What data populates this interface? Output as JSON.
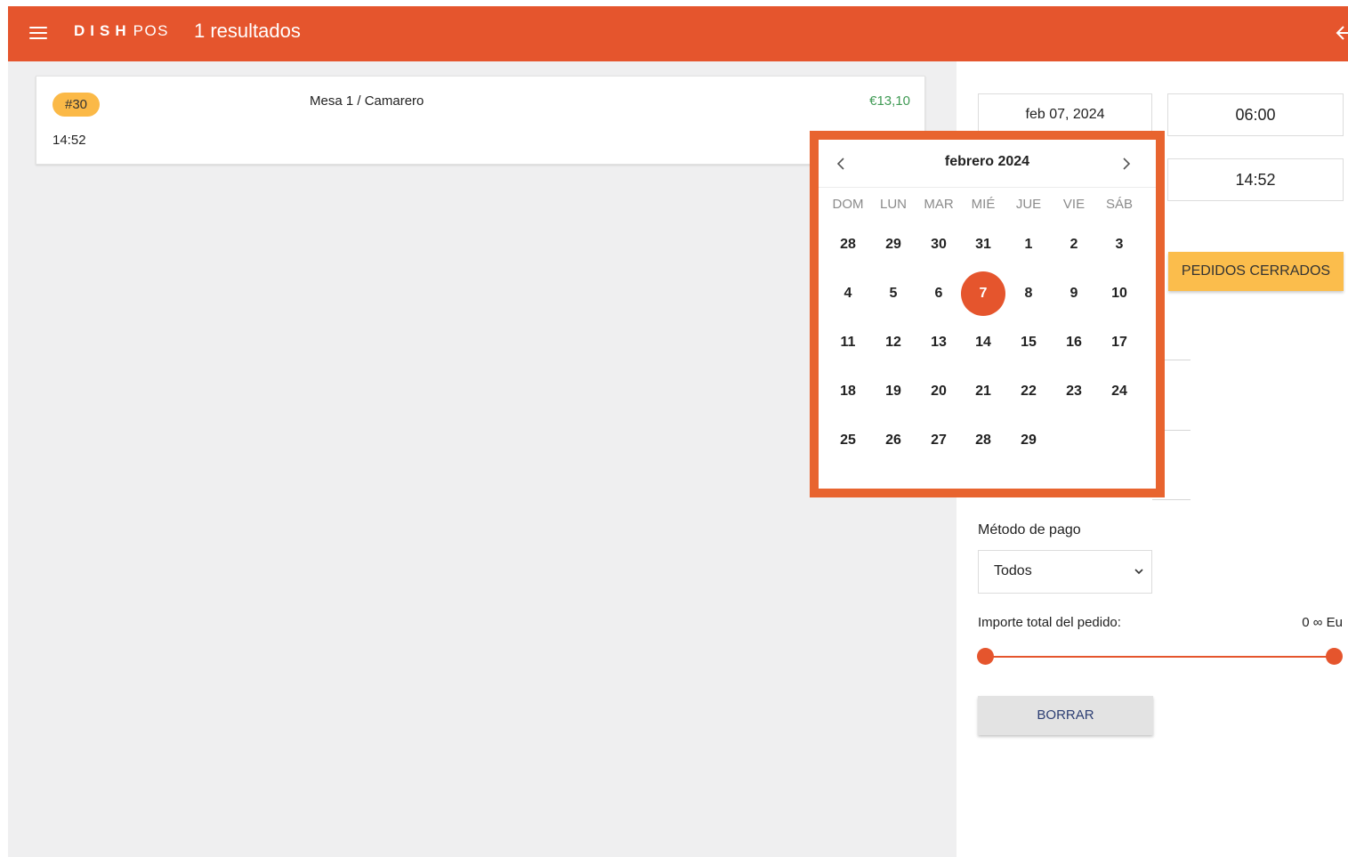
{
  "header": {
    "menu_icon": "hamburger-menu-icon",
    "brand_bold": "DISH",
    "brand_light": "POS",
    "title": "1 resultados",
    "back_icon": "back-arrow-icon"
  },
  "colors": {
    "primary": "#e5552d",
    "accent_yellow": "#fbbd4c",
    "price_green": "#3f9a54",
    "panel_gray": "#efeff0"
  },
  "orders": [
    {
      "badge": "#30",
      "table": "Mesa 1 / Camarero",
      "amount": "€13,10",
      "time": "14:52"
    }
  ],
  "filters": {
    "date": "feb 07, 2024",
    "time_from": "06:00",
    "time_to": "14:52",
    "closed_orders_button": "PEDIDOS CERRADOS",
    "payment_method_label": "Método de pago",
    "payment_method_value": "Todos",
    "order_total_label": "Importe total del pedido:",
    "order_total_value": "0 ∞ Eu",
    "clear_button": "BORRAR"
  },
  "calendar": {
    "month_label": "febrero 2024",
    "weekdays": [
      "DOM",
      "LUN",
      "MAR",
      "MIÉ",
      "JUE",
      "VIE",
      "SÁB"
    ],
    "weeks": [
      [
        "28",
        "29",
        "30",
        "31",
        "1",
        "2",
        "3"
      ],
      [
        "4",
        "5",
        "6",
        "7",
        "8",
        "9",
        "10"
      ],
      [
        "11",
        "12",
        "13",
        "14",
        "15",
        "16",
        "17"
      ],
      [
        "18",
        "19",
        "20",
        "21",
        "22",
        "23",
        "24"
      ],
      [
        "25",
        "26",
        "27",
        "28",
        "29",
        "",
        ""
      ]
    ],
    "selected_day": "7"
  }
}
